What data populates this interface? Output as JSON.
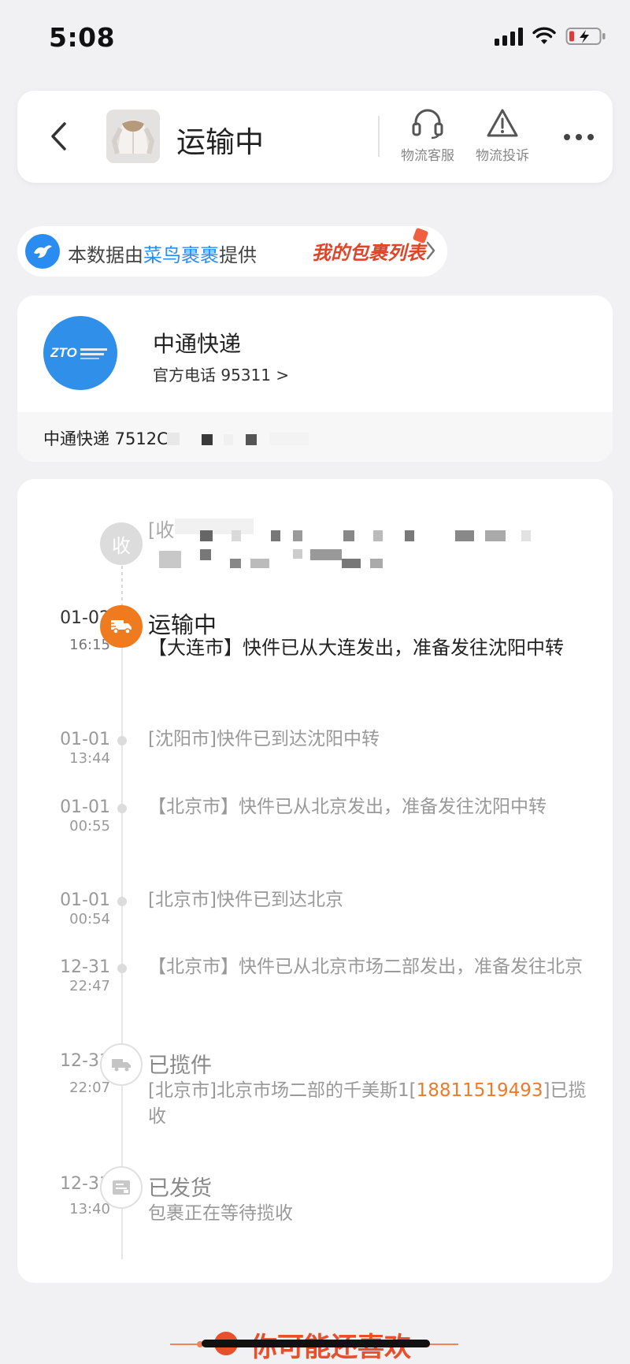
{
  "status_bar": {
    "time": "5:08"
  },
  "header": {
    "title": "运输中",
    "actions": [
      {
        "label": "物流客服",
        "icon": "headset-icon"
      },
      {
        "label": "物流投诉",
        "icon": "warning-triangle-icon"
      }
    ],
    "more_icon": "more-dots-icon"
  },
  "source_banner": {
    "prefix": "本数据由",
    "brand": "菜鸟裹裹",
    "suffix": "提供",
    "link_label": "我的包裹列表",
    "brand_color": "#2a8bf0",
    "link_color": "#e0452a"
  },
  "courier": {
    "name": "中通快递",
    "phone_text": "官方电话 95311 >",
    "tracking_label": "中通快递 7512C",
    "brand_color": "#2f8fe9"
  },
  "timeline": {
    "receive_badge": "收",
    "receive_prefix": "[收",
    "events": [
      {
        "date": "01-02",
        "time": "16:15",
        "title": "运输中",
        "desc": "【大连市】快件已从大连发出，准备发往沈阳中转",
        "active": true
      },
      {
        "date": "01-01",
        "time": "13:44",
        "desc": "[沈阳市]快件已到达沈阳中转"
      },
      {
        "date": "01-01",
        "time": "00:55",
        "desc": "【北京市】快件已从北京发出，准备发往沈阳中转"
      },
      {
        "date": "01-01",
        "time": "00:54",
        "desc": "[北京市]快件已到达北京"
      },
      {
        "date": "12-31",
        "time": "22:47",
        "desc": "【北京市】快件已从北京市场二部发出，准备发往北京"
      },
      {
        "date": "12-31",
        "time": "22:07",
        "title": "已揽件",
        "desc_prefix": "[北京市]北京市场二部的千美斯1[",
        "phone": "18811519493",
        "desc_suffix": "]已揽收"
      },
      {
        "date": "12-31",
        "time": "13:40",
        "title": "已发货",
        "desc": "包裹正在等待揽收"
      }
    ],
    "active_color": "#f07a1e"
  },
  "recommend": {
    "title": "你可能还喜欢",
    "color": "#e8502b"
  }
}
